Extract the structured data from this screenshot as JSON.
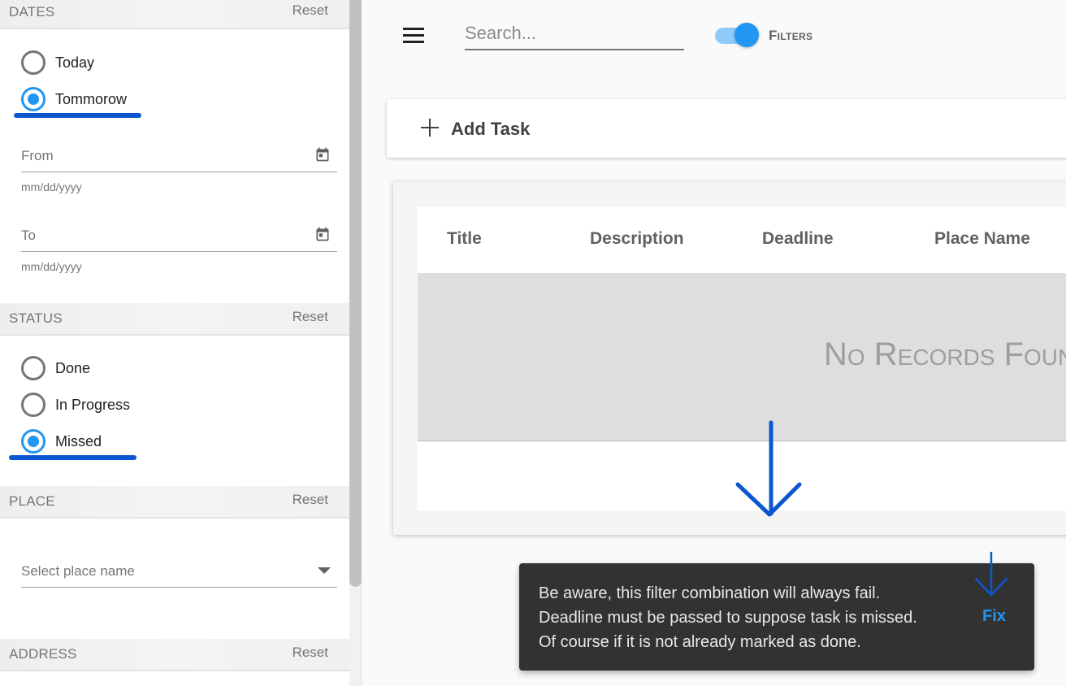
{
  "sidebar": {
    "dates": {
      "title": "DATES",
      "reset": "Reset",
      "options": [
        "Today",
        "Tommorow"
      ],
      "selected": "Tommorow",
      "from_label": "From",
      "from_helper": "mm/dd/yyyy",
      "to_label": "To",
      "to_helper": "mm/dd/yyyy"
    },
    "status": {
      "title": "STATUS",
      "reset": "Reset",
      "options": [
        "Done",
        "In Progress",
        "Missed"
      ],
      "selected": "Missed"
    },
    "place": {
      "title": "PLACE",
      "reset": "Reset",
      "select_placeholder": "Select place name"
    },
    "address": {
      "title": "ADDRESS",
      "reset": "Reset"
    }
  },
  "toolbar": {
    "menu_icon": "hamburger-menu-icon",
    "search_placeholder": "Search...",
    "filters_label": "Filters",
    "filters_on": true
  },
  "add_task": {
    "label": "Add Task",
    "icon": "plus-icon"
  },
  "table": {
    "columns": [
      "Title",
      "Description",
      "Deadline",
      "Place Name"
    ],
    "empty_message": "No Records Found"
  },
  "snackbar": {
    "lines": [
      "Be aware, this filter combination will always fail.",
      "Deadline must be passed to suppose task is missed.",
      "Of course if it is not already marked as done."
    ],
    "action": "Fix"
  },
  "colors": {
    "accent": "#2196f3",
    "annotation": "#0b57d0",
    "snackbar_bg": "#323232"
  }
}
